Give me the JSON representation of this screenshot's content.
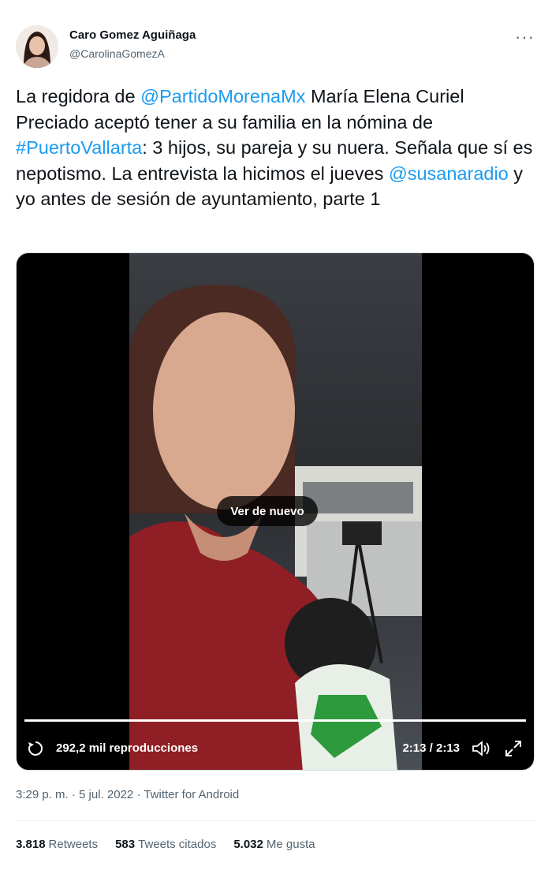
{
  "author": {
    "name": "Caro Gomez Aguiñaga",
    "handle": "@CarolinaGomezA",
    "more_label": "···"
  },
  "tweet": {
    "t1": "La regidora de ",
    "mention1": "@PartidoMorenaMx",
    "t2": " María Elena Curiel Preciado aceptó tener a su familia en la nómina de ",
    "hashtag": "#PuertoVallarta",
    "t3": ": 3 hijos, su pareja y su nuera. Señala que sí es nepotismo. La entrevista la hicimos el jueves ",
    "mention2": "@susanaradio",
    "t4": " y yo antes de sesión de ayuntamiento, parte 1"
  },
  "video": {
    "replay_label": "Ver de nuevo",
    "views": "292,2 mil reproducciones",
    "time": "2:13 / 2:13",
    "progress": 1.0
  },
  "meta": {
    "time": "3:29 p. m.",
    "sep1": " · ",
    "date": "5 jul. 2022",
    "sep2": " · ",
    "source": "Twitter for Android"
  },
  "stats": {
    "retweets_count": "3.818",
    "retweets_label": "Retweets",
    "quotes_count": "583",
    "quotes_label": "Tweets citados",
    "likes_count": "5.032",
    "likes_label": "Me gusta"
  },
  "colors": {
    "link": "#1d9bf0",
    "secondary_text": "#536471"
  }
}
